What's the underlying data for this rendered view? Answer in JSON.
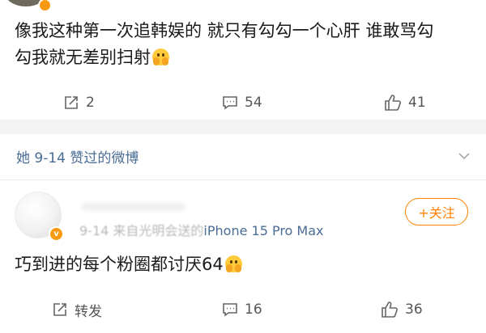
{
  "post1": {
    "text_line1": "像我这种第一次追韩娱的 就只有勾勾一个心肝 谁敢骂勾",
    "text_line2": "勾我就无差别扫射",
    "emoji": "scared-face-emoji",
    "actions": {
      "repost": "2",
      "comment": "54",
      "like": "41"
    }
  },
  "like_header": {
    "label": "她 9-14 赞过的微博"
  },
  "post2": {
    "date": "9-14",
    "source_prefix": "来自光明会送的",
    "device": "iPhone 15 Pro Max",
    "follow_label": "+关注",
    "text": "巧到进的每个粉圈都讨厌64",
    "emoji": "scared-face-emoji",
    "actions": {
      "repost": "转发",
      "comment": "16",
      "like": "36"
    }
  },
  "colors": {
    "accent": "#ff8200",
    "link": "#4a6c95",
    "divider": "#f3f3f3",
    "verified_badge": "#f79a0f"
  },
  "icons": [
    "repost-icon",
    "comment-icon",
    "like-icon",
    "chevron-down-icon"
  ]
}
